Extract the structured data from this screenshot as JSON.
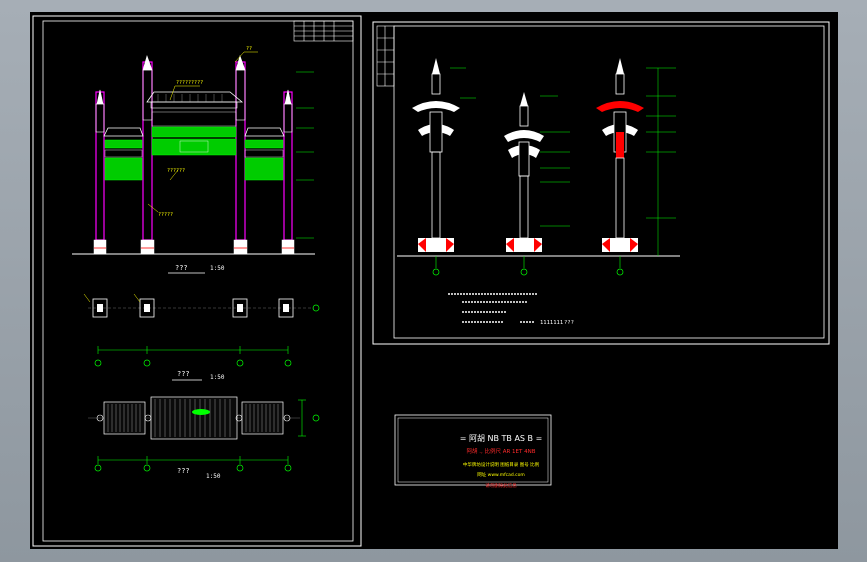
{
  "app": {
    "name": "CAD drawing viewer"
  },
  "colors": {
    "background": "#9aa3ab",
    "model_space": "#000000",
    "sheet_line": "#ffffff",
    "elevation_line": "#ff00ff",
    "hatch_fill": "#00ff00",
    "dimension": "#00ff00",
    "text_yellow": "#ffff00",
    "accent_red": "#ff0000"
  },
  "sheet_left": {
    "front_elevation_label": "???",
    "front_elevation_scale": "1:50",
    "plan_label": "???",
    "plan_scale": "1:50",
    "bottom_plan_label": "???",
    "bottom_plan_scale": "1:50",
    "roof_tag": "?????????",
    "ridge_tag": "??",
    "beam_tag": "??????",
    "base_tag": "?????",
    "column_count": 4
  },
  "sheet_right": {
    "views_count": 3,
    "note_number": "1111111",
    "note_label": "???"
  },
  "titleblock": {
    "line1": "= 阿胡 NB TB AS B =",
    "line2": "阿胡 ., 比例尺 AR 1ET 4NB",
    "line3": "中华牌坊设计说明 图纸目录 图号 比例",
    "line4": "网址 www.mfcad.com",
    "line5": "请勿删除此信息"
  }
}
